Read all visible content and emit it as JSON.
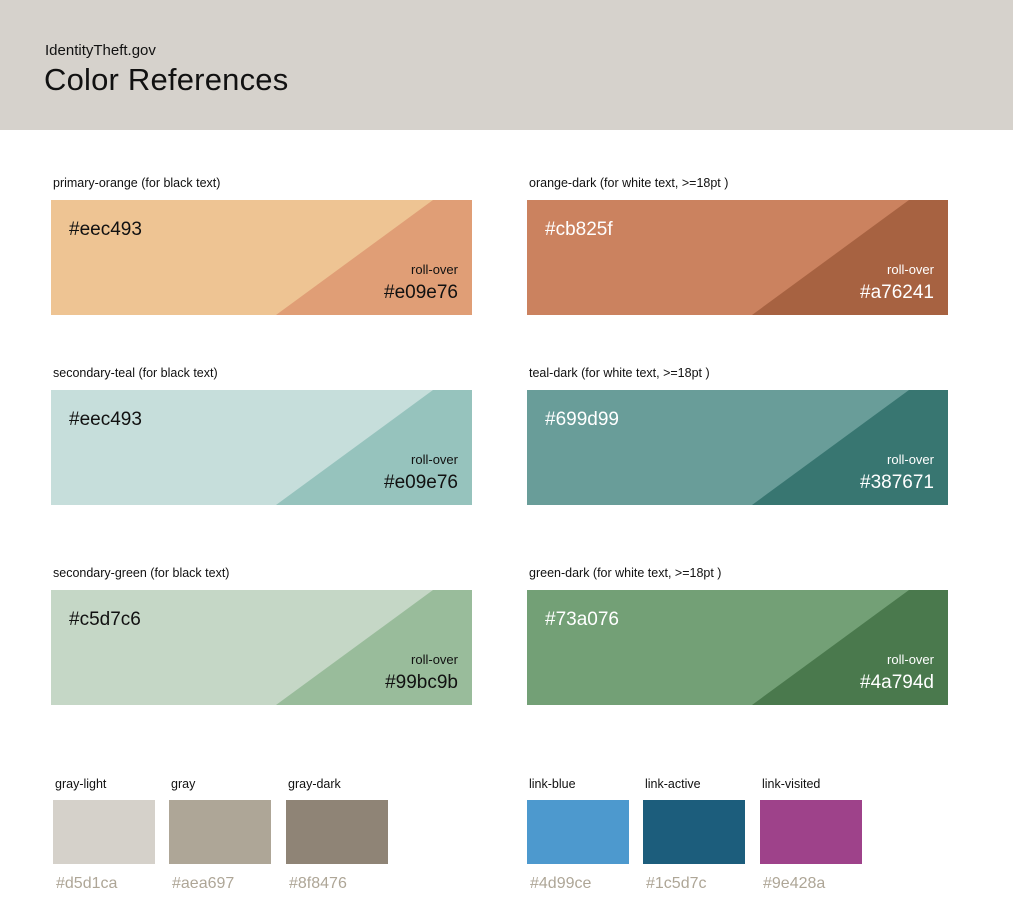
{
  "header": {
    "site": "IdentityTheft.gov",
    "title": "Color References",
    "bg": "#d6d2cc"
  },
  "swatches": [
    {
      "label": "primary-orange (for black text)",
      "hex": "#eec493",
      "rollover_label": "roll-over",
      "rollover_hex": "#e09e76",
      "color": "#eec493",
      "rollover_color": "#e09e76",
      "text": "dark"
    },
    {
      "label": "orange-dark (for white text,  >=18pt )",
      "hex": "#cb825f",
      "rollover_label": "roll-over",
      "rollover_hex": "#a76241",
      "color": "#cb825f",
      "rollover_color": "#a76241",
      "text": "light"
    },
    {
      "label": "secondary-teal (for black text)",
      "hex": "#eec493",
      "rollover_label": "roll-over",
      "rollover_hex": "#e09e76",
      "color": "#c6dedb",
      "rollover_color": "#96c3bd",
      "text": "dark"
    },
    {
      "label": "teal-dark (for white text,  >=18pt )",
      "hex": "#699d99",
      "rollover_label": "roll-over",
      "rollover_hex": "#387671",
      "color": "#699d99",
      "rollover_color": "#387671",
      "text": "light"
    },
    {
      "label": "secondary-green (for black text)",
      "hex": "#c5d7c6",
      "rollover_label": "roll-over",
      "rollover_hex": "#99bc9b",
      "color": "#c5d7c6",
      "rollover_color": "#99bc9b",
      "text": "dark"
    },
    {
      "label": "green-dark (for white text, >=18pt )",
      "hex": "#73a076",
      "rollover_label": "roll-over",
      "rollover_hex": "#4a794d",
      "color": "#73a076",
      "rollover_color": "#4a794d",
      "text": "light"
    }
  ],
  "grays": [
    {
      "label": "gray-light",
      "hex": "#d5d1ca",
      "color": "#d5d1ca"
    },
    {
      "label": "gray",
      "hex": "#aea697",
      "color": "#aea697"
    },
    {
      "label": "gray-dark",
      "hex": "#8f8476",
      "color": "#8f8476"
    }
  ],
  "links": [
    {
      "label": "link-blue",
      "hex": "#4d99ce",
      "color": "#4d99ce"
    },
    {
      "label": "link-active",
      "hex": "#1c5d7c",
      "color": "#1c5d7c"
    },
    {
      "label": "link-visited",
      "hex": "#9e428a",
      "color": "#9e428a"
    }
  ],
  "hex_caption_color": "#aea697"
}
